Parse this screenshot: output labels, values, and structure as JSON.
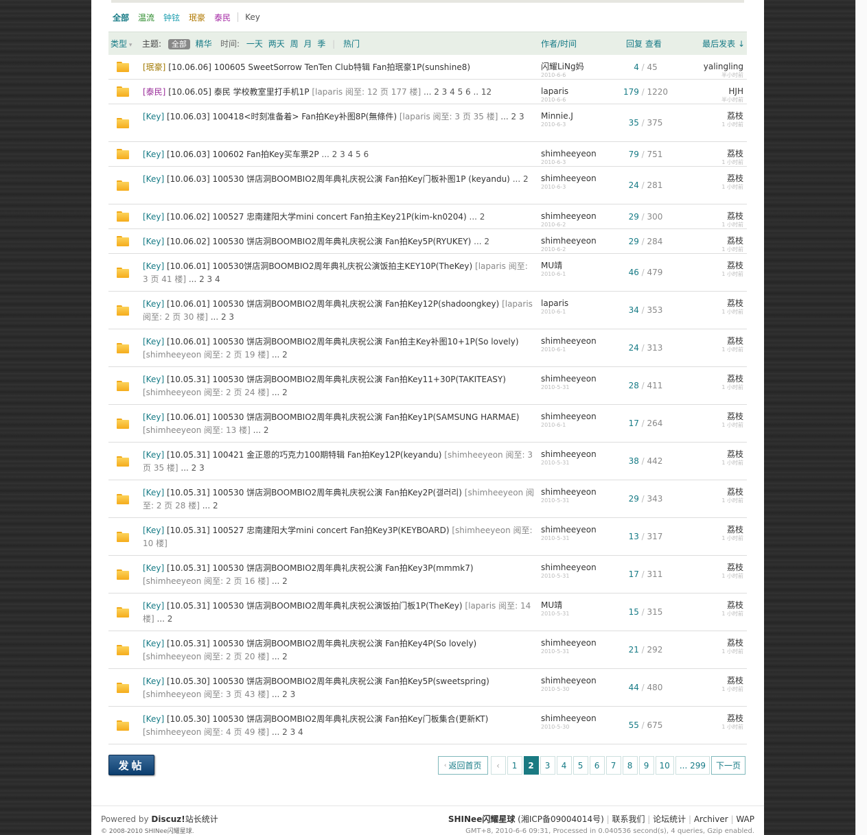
{
  "filter_types": [
    {
      "label": "全部",
      "color": "#157a85",
      "bold": true
    },
    {
      "label": "温流",
      "color": "#2a8a2a"
    },
    {
      "label": "钟铉",
      "color": "#1f9fb0"
    },
    {
      "label": "珉豪",
      "color": "#b07800"
    },
    {
      "label": "泰民",
      "color": "#a52aa5"
    },
    {
      "label": "Key",
      "color": "#555555"
    }
  ],
  "header": {
    "type": "类型",
    "subject": "主题:",
    "all": "全部",
    "digest": "精华",
    "time": "时间:",
    "day": "一天",
    "twodays": "两天",
    "week": "周",
    "month": "月",
    "season": "季",
    "hot": "热门",
    "author": "作者/时间",
    "replies": "回复",
    "views": "查看",
    "lastpost": "最后发表"
  },
  "rows": [
    {
      "tag": "[珉豪]",
      "tagtype": "zh",
      "title": " [10.06.06] 100605 SweetSorrow TenTen Club特辑 Fan拍珉豪1P(sunshine8)",
      "extra": "",
      "pages": "",
      "author": "闪耀LiNg妈",
      "date": "2010-6-6",
      "replies": "4",
      "views": "45",
      "last": "yalingling",
      "lasttime": "半小时前",
      "h": 36
    },
    {
      "tag": "[泰民]",
      "tagtype": "tm",
      "title": " [10.06.05] 泰民 学校教室里打手机1P",
      "extra": " [laparis 阅至: 12 页 177 楼]",
      "pages": " ... 2 3 4 5 6 .. 12",
      "author": "laparis",
      "date": "2010-6-6",
      "replies": "179",
      "views": "1220",
      "last": "HJH",
      "lasttime": "半小时前",
      "h": 36
    },
    {
      "tag": "[Key]",
      "tagtype": "k",
      "title": " [10.06.03] 100418<时刻准备着> Fan拍Key补图8P(無條件)",
      "extra": " [laparis 阅至: 3 页 35 楼]",
      "pages": " ... 2 3",
      "author": "Minnie.J",
      "date": "2010-6-3",
      "replies": "35",
      "views": "375",
      "last": "荔枝",
      "lasttime": "1 小时前",
      "h": 55
    },
    {
      "tag": "[Key]",
      "tagtype": "k",
      "title": " [10.06.03] 100602 Fan拍Key买车票2P",
      "extra": "",
      "pages": " ... 2 3 4 5 6",
      "author": "shimheeyeon",
      "date": "2010-6-3",
      "replies": "79",
      "views": "751",
      "last": "荔枝",
      "lasttime": "1 小时前",
      "h": 36
    },
    {
      "tag": "[Key]",
      "tagtype": "k",
      "title": " [10.06.03] 100530 饼店洞BOOMBIO2周年典礼庆祝公演 Fan拍Key门板补图1P (keyandu)",
      "extra": "",
      "pages": " ... 2",
      "author": "shimheeyeon",
      "date": "2010-6-3",
      "replies": "24",
      "views": "281",
      "last": "荔枝",
      "lasttime": "1 小时前",
      "h": 55
    },
    {
      "tag": "[Key]",
      "tagtype": "k",
      "title": " [10.06.02] 100527 忠南建阳大学mini concert Fan拍主Key21P(kim-kn0204)",
      "extra": "",
      "pages": " ... 2",
      "author": "shimheeyeon",
      "date": "2010-6-2",
      "replies": "29",
      "views": "300",
      "last": "荔枝",
      "lasttime": "1 小时前",
      "h": 36
    },
    {
      "tag": "[Key]",
      "tagtype": "k",
      "title": " [10.06.02] 100530 饼店洞BOOMBIO2周年典礼庆祝公演 Fan拍Key5P(RYUKEY)",
      "extra": "",
      "pages": " ... 2",
      "author": "shimheeyeon",
      "date": "2010-6-2",
      "replies": "29",
      "views": "284",
      "last": "荔枝",
      "lasttime": "1 小时前",
      "h": 36
    },
    {
      "tag": "[Key]",
      "tagtype": "k",
      "title": " [10.06.01] 100530饼店洞BOOMBIO2周年典礼庆祝公演饭拍主KEY10P(TheKey)",
      "extra": " [laparis 阅至: 3 页 41 楼]",
      "pages": " ... 2 3 4",
      "author": "MU靖",
      "date": "2010-6-1",
      "replies": "46",
      "views": "479",
      "last": "荔枝",
      "lasttime": "1 小时前",
      "h": 55
    },
    {
      "tag": "[Key]",
      "tagtype": "k",
      "title": " [10.06.01] 100530 饼店洞BOOMBIO2周年典礼庆祝公演 Fan拍Key12P(shadoongkey)",
      "extra": " [laparis 阅至: 2 页 30 楼]",
      "pages": " ... 2 3",
      "author": "laparis",
      "date": "2010-6-1",
      "replies": "34",
      "views": "353",
      "last": "荔枝",
      "lasttime": "1 小时前",
      "h": 55
    },
    {
      "tag": "[Key]",
      "tagtype": "k",
      "title": " [10.06.01] 100530 饼店洞BOOMBIO2周年典礼庆祝公演 Fan拍主Key补图10+1P(So lovely)",
      "extra": " [shimheeyeon 阅至: 2 页 19 楼]",
      "pages": " ... 2",
      "author": "shimheeyeon",
      "date": "2010-6-1",
      "replies": "24",
      "views": "313",
      "last": "荔枝",
      "lasttime": "1 小时前",
      "h": 55
    },
    {
      "tag": "[Key]",
      "tagtype": "k",
      "title": " [10.05.31] 100530 饼店洞BOOMBIO2周年典礼庆祝公演 Fan拍Key11+30P(TAKITEASY)",
      "extra": " [shimheeyeon 阅至: 2 页 24 楼]",
      "pages": " ... 2",
      "author": "shimheeyeon",
      "date": "2010-5-31",
      "replies": "28",
      "views": "411",
      "last": "荔枝",
      "lasttime": "1 小时前",
      "h": 55
    },
    {
      "tag": "[Key]",
      "tagtype": "k",
      "title": " [10.06.01] 100530 饼店洞BOOMBIO2周年典礼庆祝公演 Fan拍Key1P(SAMSUNG HARMAE)",
      "extra": " [shimheeyeon 阅至: 13 楼]",
      "pages": " ... 2",
      "author": "shimheeyeon",
      "date": "2010-6-1",
      "replies": "17",
      "views": "264",
      "last": "荔枝",
      "lasttime": "1 小时前",
      "h": 55
    },
    {
      "tag": "[Key]",
      "tagtype": "k",
      "title": " [10.05.31] 100421 金正恩的巧克力100期特辑 Fan拍Key12P(keyandu)",
      "extra": " [shimheeyeon 阅至: 3 页 35 楼]",
      "pages": " ... 2 3",
      "author": "shimheeyeon",
      "date": "2010-5-31",
      "replies": "38",
      "views": "442",
      "last": "荔枝",
      "lasttime": "1 小时前",
      "h": 55
    },
    {
      "tag": "[Key]",
      "tagtype": "k",
      "title": " [10.05.31] 100530 饼店洞BOOMBIO2周年典礼庆祝公演 Fan拍Key2P(갤러리)",
      "extra": " [shimheeyeon 阅至: 2 页 28 楼]",
      "pages": " ... 2",
      "author": "shimheeyeon",
      "date": "2010-5-31",
      "replies": "29",
      "views": "343",
      "last": "荔枝",
      "lasttime": "1 小时前",
      "h": 55
    },
    {
      "tag": "[Key]",
      "tagtype": "k",
      "title": " [10.05.31] 100527 忠南建阳大学mini concert Fan拍Key3P(KEYBOARD)",
      "extra": " [shimheeyeon 阅至: 10 楼]",
      "pages": "",
      "author": "shimheeyeon",
      "date": "2010-5-31",
      "replies": "13",
      "views": "317",
      "last": "荔枝",
      "lasttime": "1 小时前",
      "h": 55
    },
    {
      "tag": "[Key]",
      "tagtype": "k",
      "title": " [10.05.31] 100530 饼店洞BOOMBIO2周年典礼庆祝公演 Fan拍Key3P(mmmk7)",
      "extra": " [shimheeyeon 阅至: 2 页 16 楼]",
      "pages": " ... 2",
      "author": "shimheeyeon",
      "date": "2010-5-31",
      "replies": "17",
      "views": "311",
      "last": "荔枝",
      "lasttime": "1 小时前",
      "h": 55
    },
    {
      "tag": "[Key]",
      "tagtype": "k",
      "title": " [10.05.31] 100530 饼店洞BOOMBIO2周年典礼庆祝公演饭拍门板1P(TheKey)",
      "extra": " [laparis 阅至: 14 楼]",
      "pages": " ... 2",
      "author": "MU靖",
      "date": "2010-5-31",
      "replies": "15",
      "views": "315",
      "last": "荔枝",
      "lasttime": "1 小时前",
      "h": 55
    },
    {
      "tag": "[Key]",
      "tagtype": "k",
      "title": " [10.05.31] 100530 饼店洞BOOMBIO2周年典礼庆祝公演 Fan拍Key4P(So lovely)",
      "extra": " [shimheeyeon 阅至: 2 页 20 楼]",
      "pages": " ... 2",
      "author": "shimheeyeon",
      "date": "2010-5-31",
      "replies": "21",
      "views": "292",
      "last": "荔枝",
      "lasttime": "1 小时前",
      "h": 55
    },
    {
      "tag": "[Key]",
      "tagtype": "k",
      "title": " [10.05.30] 100530 饼店洞BOOMBIO2周年典礼庆祝公演 Fan拍Key5P(sweetspring)",
      "extra": " [shimheeyeon 阅至: 3 页 43 楼]",
      "pages": " ... 2 3",
      "author": "shimheeyeon",
      "date": "2010-5-30",
      "replies": "44",
      "views": "480",
      "last": "荔枝",
      "lasttime": "1 小时前",
      "h": 55
    },
    {
      "tag": "[Key]",
      "tagtype": "k",
      "title": " [10.05.30] 100530 饼店洞BOOMBIO2周年典礼庆祝公演 Fan拍Key门板集合(更新KT)",
      "extra": " [shimheeyeon 阅至: 4 页 49 楼]",
      "pages": " ... 2 3 4",
      "author": "shimheeyeon",
      "date": "2010-5-30",
      "replies": "55",
      "views": "675",
      "last": "荔枝",
      "lasttime": "1 小时前",
      "h": 55
    }
  ],
  "newpost_label": "发帖",
  "pagination": {
    "back": "返回首页",
    "prev": "‹",
    "pages": [
      "1",
      "2",
      "3",
      "4",
      "5",
      "6",
      "7",
      "8",
      "9",
      "10"
    ],
    "current": "2",
    "last": "... 299",
    "next": "下一页"
  },
  "footer": {
    "powered": "Powered by",
    "brand": "Discuz!",
    "stats": "站长统计",
    "copyright": "© 2008-2010 SHINee闪耀星球.",
    "site": "SHINee闪耀星球",
    "icp": "(湘ICP备09004014号)",
    "contact": "联系我们",
    "forumstats": "论坛统计",
    "archiver": "Archiver",
    "wap": "WAP",
    "gmt": "GMT+8, 2010-6-6 09:31, Processed in 0.040536 second(s), 4 queries, Gzip enabled."
  }
}
